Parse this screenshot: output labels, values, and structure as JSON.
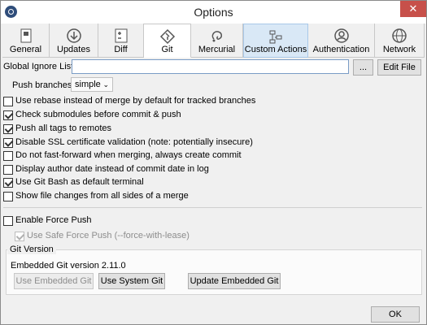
{
  "window": {
    "title": "Options",
    "close": "✕"
  },
  "tabs": [
    {
      "label": "General",
      "icon": "general-icon"
    },
    {
      "label": "Updates",
      "icon": "updates-icon"
    },
    {
      "label": "Diff",
      "icon": "diff-icon"
    },
    {
      "label": "Git",
      "icon": "git-icon"
    },
    {
      "label": "Mercurial",
      "icon": "mercurial-icon"
    },
    {
      "label": "Custom Actions",
      "icon": "custom-actions-icon"
    },
    {
      "label": "Authentication",
      "icon": "authentication-icon"
    },
    {
      "label": "Network",
      "icon": "network-icon"
    }
  ],
  "git": {
    "ignore_label": "Global Ignore List:",
    "ignore_value": "",
    "browse_label": "...",
    "edit_file_label": "Edit File",
    "push_branches_label": "Push branches:",
    "push_branches_value": "simple",
    "options": [
      {
        "label": "Use rebase instead of merge by default for tracked branches",
        "checked": false
      },
      {
        "label": "Check submodules before commit & push",
        "checked": true
      },
      {
        "label": "Push all tags to remotes",
        "checked": true
      },
      {
        "label": "Disable SSL certificate validation (note: potentially insecure)",
        "checked": true
      },
      {
        "label": "Do not fast-forward when merging, always create commit",
        "checked": false
      },
      {
        "label": "Display author date instead of commit date in log",
        "checked": false
      },
      {
        "label": "Use Git Bash as default terminal",
        "checked": true
      },
      {
        "label": "Show file changes from all sides of a merge",
        "checked": false
      }
    ],
    "force_push": {
      "label": "Enable Force Push",
      "checked": false
    },
    "safe_force_push": {
      "label": "Use Safe Force Push (--force-with-lease)",
      "checked": true,
      "disabled": true
    },
    "version_group_title": "Git Version",
    "embedded_version_text": "Embedded Git version 2.11.0",
    "use_embedded_label": "Use Embedded Git",
    "use_system_label": "Use System Git",
    "update_embedded_label": "Update Embedded Git"
  },
  "footer": {
    "ok_label": "OK"
  },
  "colors": {
    "accent": "#d9e8f6",
    "close": "#c7504a",
    "textbox_border": "#7a9cc6"
  }
}
